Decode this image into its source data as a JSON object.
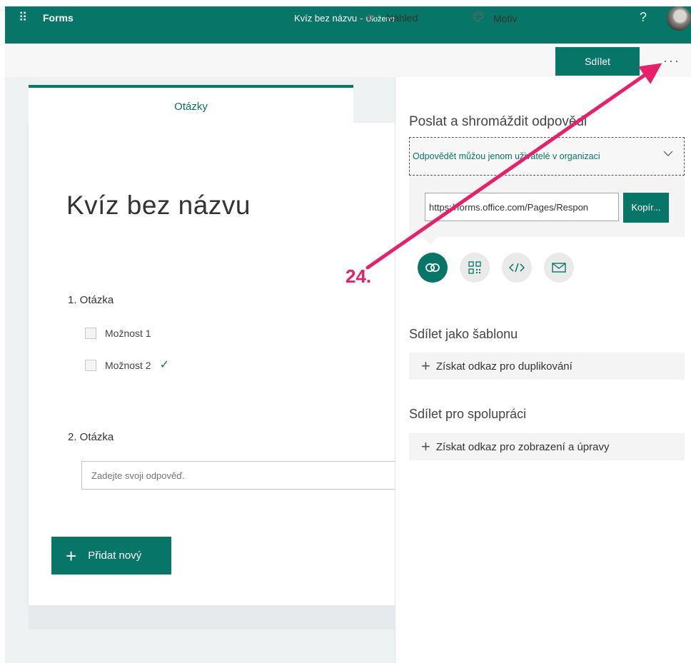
{
  "topbar": {
    "brand": "Forms",
    "title": "Kvíz bez názvu",
    "separator": "-",
    "status": "Uloženo",
    "help": "?"
  },
  "commands": {
    "preview": "Náhled",
    "theme": "Motiv",
    "share": "Sdílet",
    "more": "···"
  },
  "tabs": {
    "questions": "Otázky"
  },
  "form": {
    "title": "Kvíz bez názvu",
    "q1": {
      "label": "1. Otázka",
      "options": [
        "Možnost 1",
        "Možnost 2"
      ],
      "correct_mark": "✓"
    },
    "q2": {
      "label": "2. Otázka",
      "placeholder": "Zadejte svoji odpověď."
    },
    "add_new": "Přidat nový"
  },
  "share_panel": {
    "title": "Poslat a shromáždit odpovědi",
    "audience": "Odpovědět můžou jenom uživatelé v organizaci",
    "link": "https://forms.office.com/Pages/Respon",
    "copy": "Kopír...",
    "template_title": "Sdílet jako šablonu",
    "template_link": "Získat odkaz pro duplikování",
    "collab_title": "Sdílet pro spolupráci",
    "collab_link": "Získat odkaz pro zobrazení a úpravy"
  },
  "annotation": {
    "step": "24.",
    "color": "#e6206a"
  },
  "colors": {
    "accent": "#077568"
  }
}
